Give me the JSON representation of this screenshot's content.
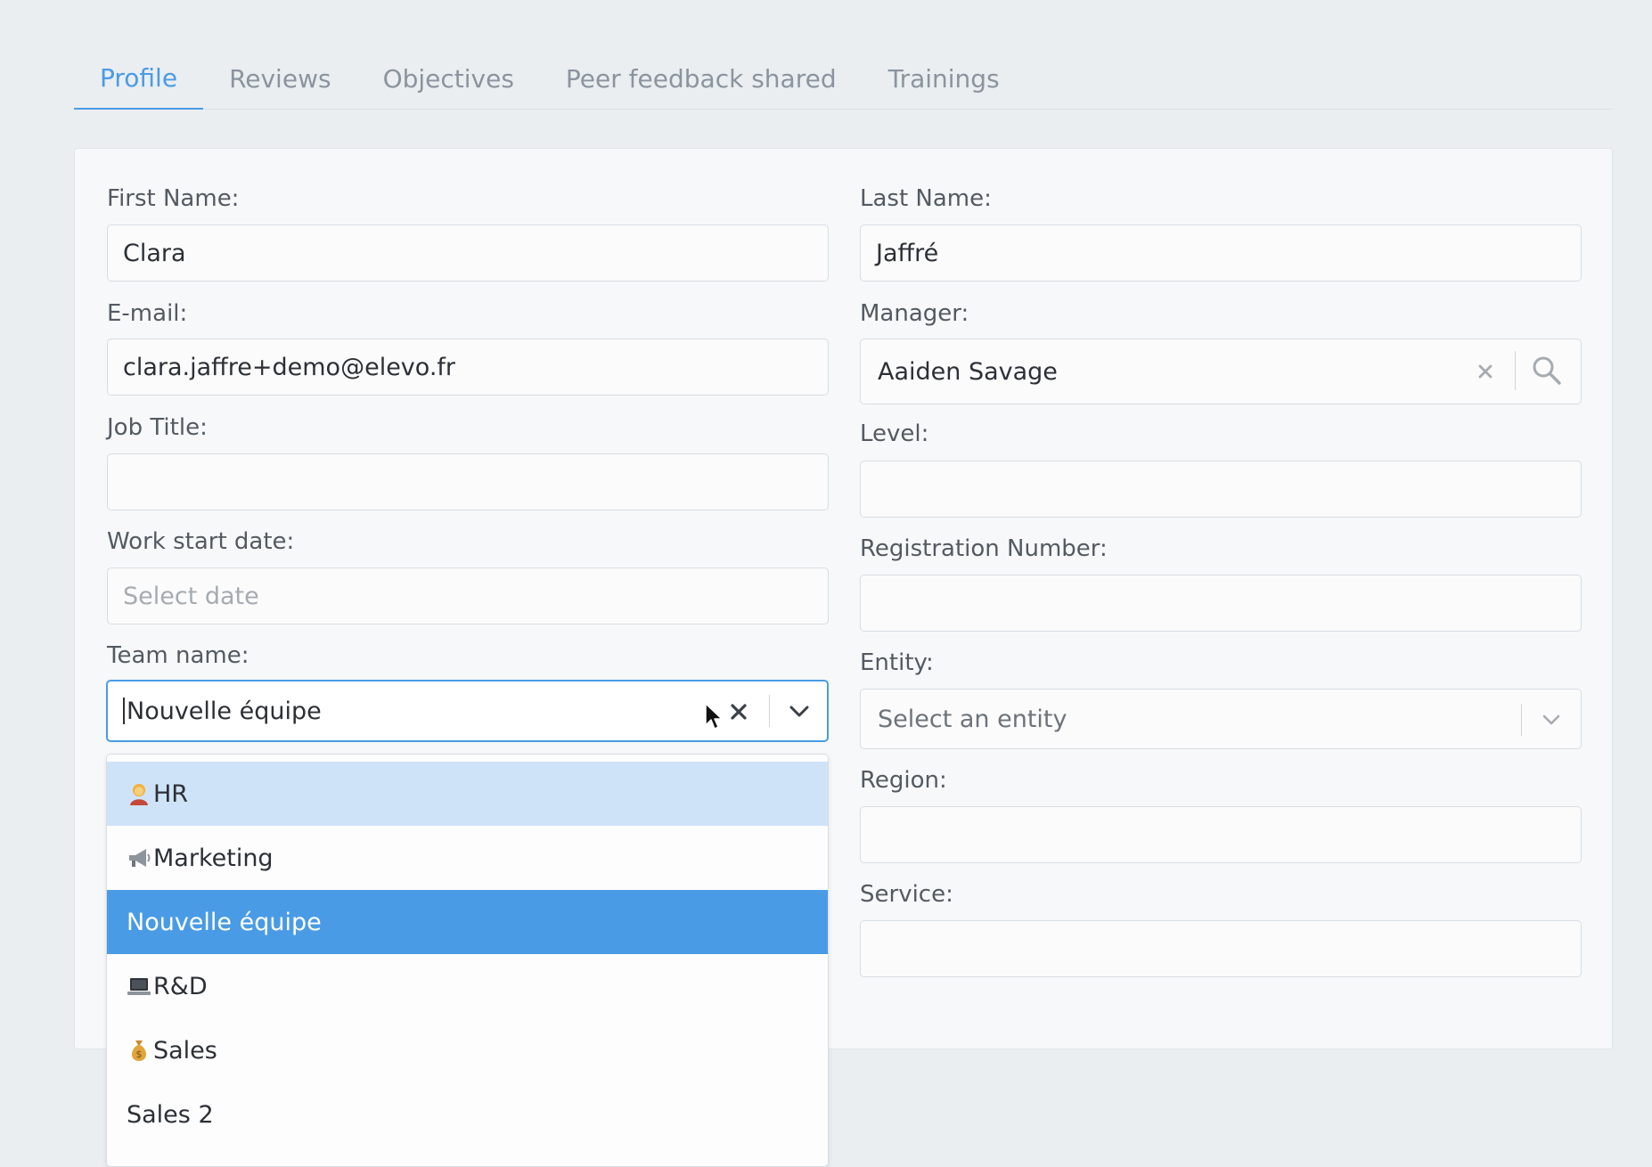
{
  "tabs": [
    {
      "label": "Profile",
      "active": true
    },
    {
      "label": "Reviews",
      "active": false
    },
    {
      "label": "Objectives",
      "active": false
    },
    {
      "label": "Peer feedback shared",
      "active": false
    },
    {
      "label": "Trainings",
      "active": false
    }
  ],
  "form": {
    "first_name": {
      "label": "First Name:",
      "value": "Clara"
    },
    "last_name": {
      "label": "Last Name:",
      "value": "Jaffré"
    },
    "email": {
      "label": "E-mail:",
      "value": "clara.jaffre+demo@elevo.fr"
    },
    "manager": {
      "label": "Manager:",
      "value": "Aaiden Savage",
      "clear_icon": "close-icon",
      "search_icon": "search-icon"
    },
    "job_title": {
      "label": "Job Title:",
      "value": ""
    },
    "level": {
      "label": "Level:",
      "value": ""
    },
    "work_start_date": {
      "label": "Work start date:",
      "placeholder": "Select date"
    },
    "registration_number": {
      "label": "Registration Number:",
      "value": ""
    },
    "team_name": {
      "label": "Team name:",
      "value": "Nouvelle équipe",
      "clear_icon": "close-icon",
      "dropdown_icon": "chevron-down-icon"
    },
    "entity": {
      "label": "Entity:",
      "placeholder": "Select an entity",
      "dropdown_icon": "chevron-down-icon"
    },
    "region": {
      "label": "Region:",
      "value": ""
    },
    "service": {
      "label": "Service:",
      "value": ""
    }
  },
  "team_dropdown": {
    "options": [
      {
        "label": "HR",
        "icon": "person-emoji",
        "state": "hover"
      },
      {
        "label": "Marketing",
        "icon": "megaphone-emoji",
        "state": "normal"
      },
      {
        "label": "Nouvelle équipe",
        "icon": "",
        "state": "selected"
      },
      {
        "label": "R&D",
        "icon": "laptop-emoji",
        "state": "normal"
      },
      {
        "label": "Sales",
        "icon": "money-bag-emoji",
        "state": "normal"
      },
      {
        "label": "Sales 2",
        "icon": "",
        "state": "normal"
      }
    ]
  },
  "colors": {
    "accent": "#4a9be5",
    "hover": "#cfe3f8",
    "background": "#eaeef1"
  }
}
